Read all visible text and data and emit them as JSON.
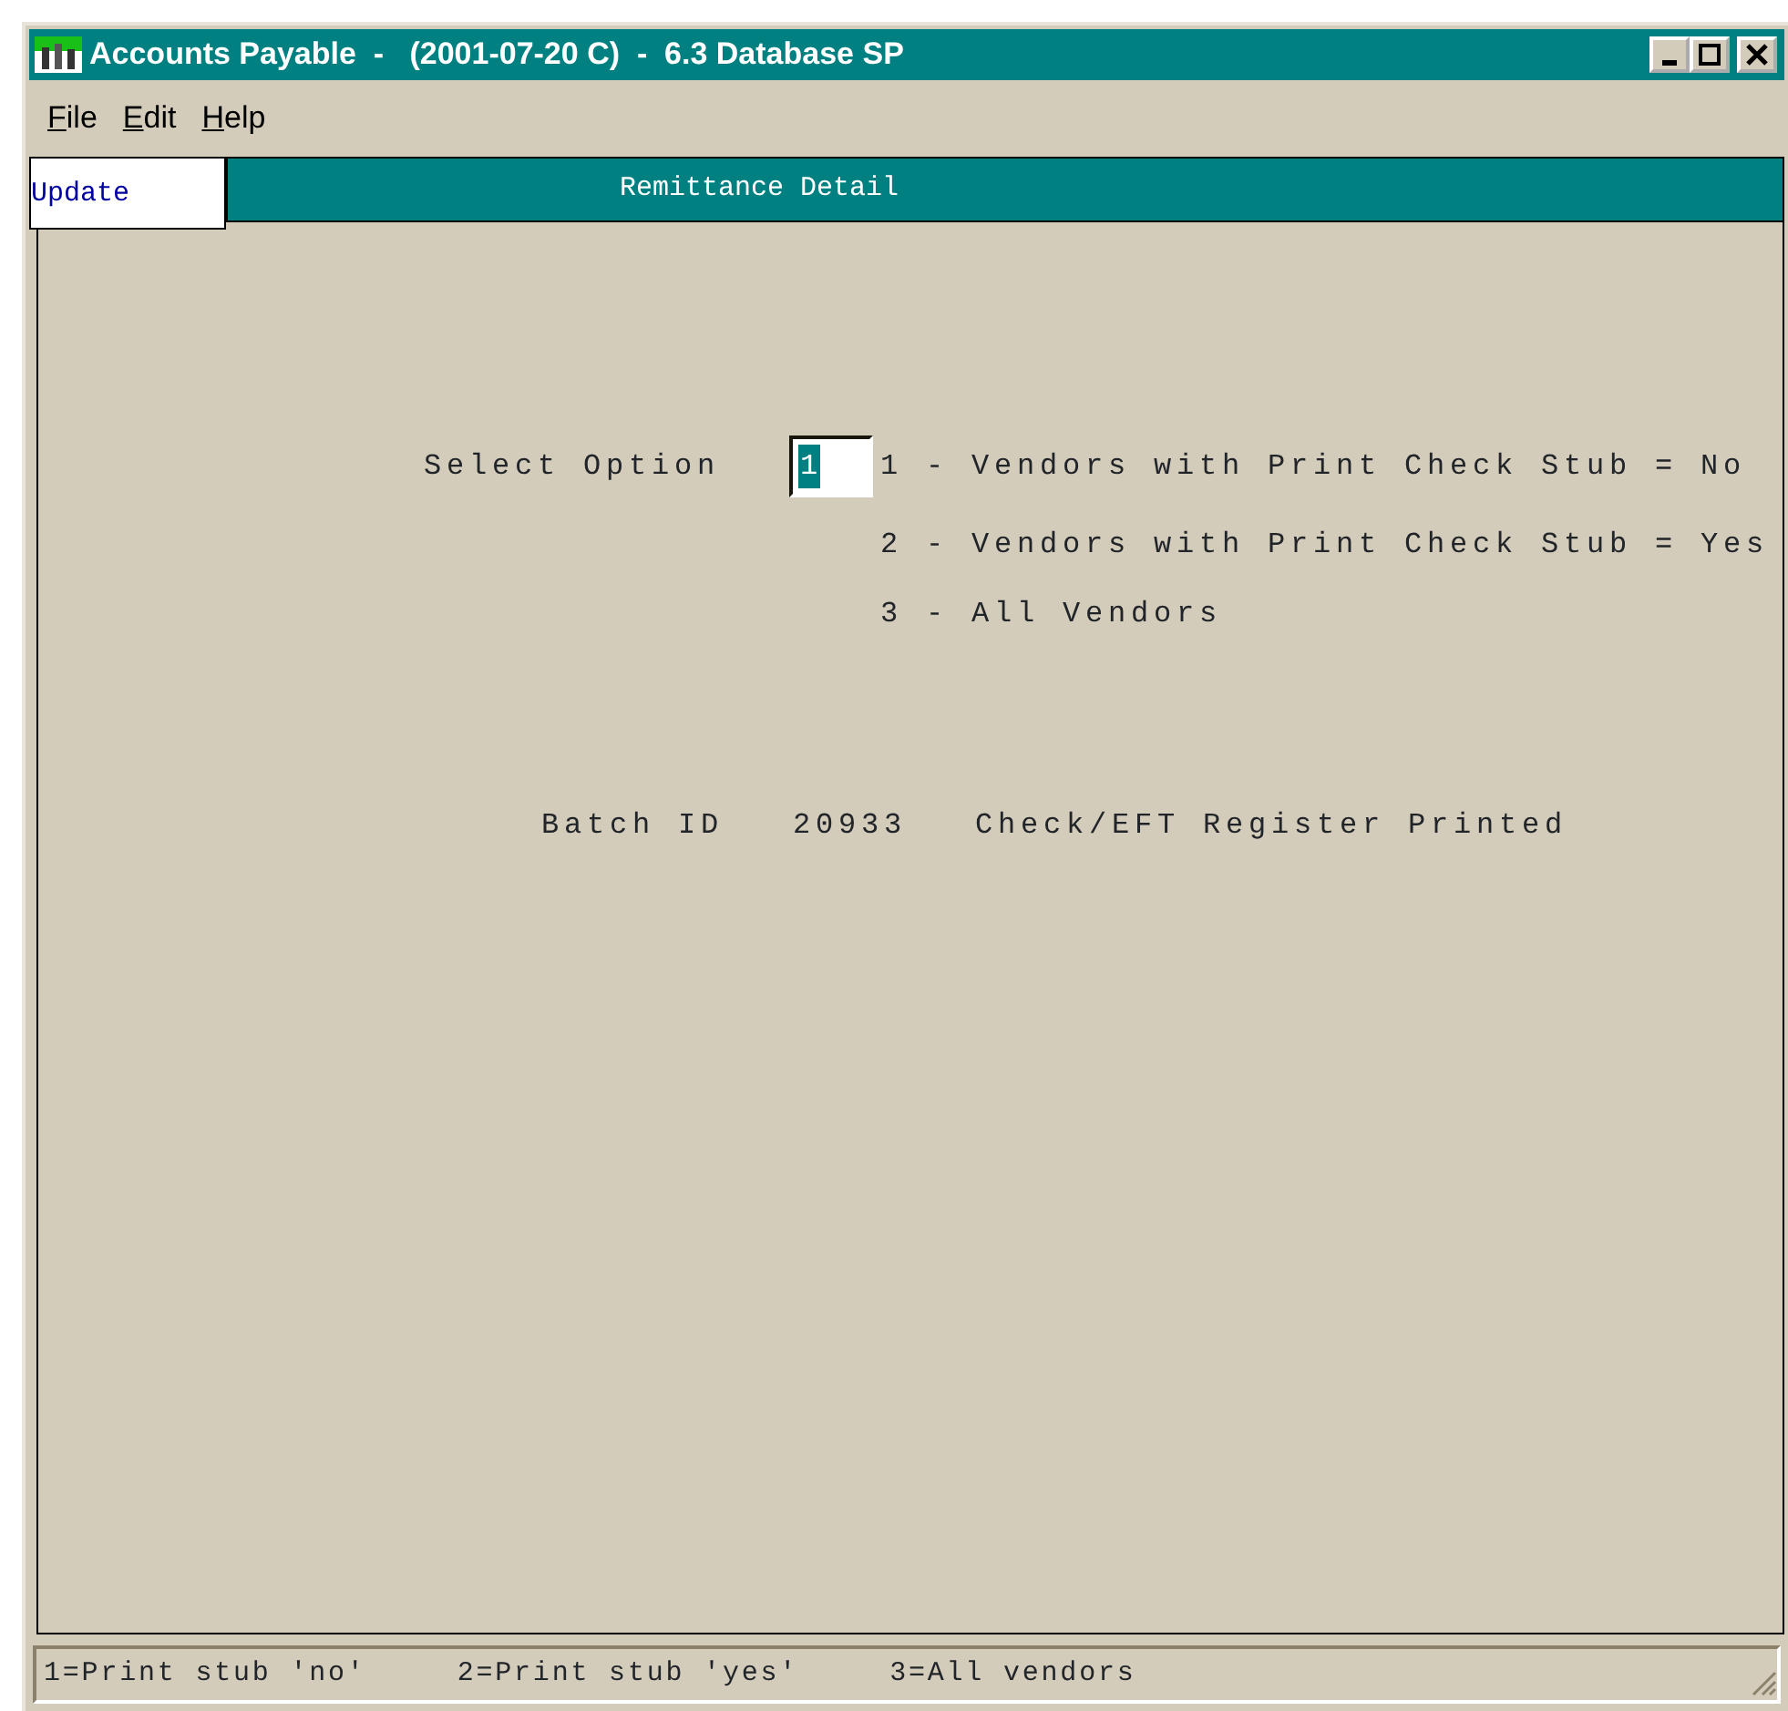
{
  "window": {
    "title": "Accounts Payable  -   (2001-07-20 C)  -  6.3 Database SP"
  },
  "menu": [
    "File",
    "Edit",
    "Help"
  ],
  "mode": "Update",
  "screen_title": "Remittance Detail",
  "select_option": {
    "label": "Select Option",
    "value": "1",
    "options": [
      "1 - Vendors with Print Check Stub = No",
      "2 - Vendors with Print Check Stub = Yes",
      "3 - All Vendors"
    ]
  },
  "batch": {
    "label": "Batch ID",
    "value": "20933",
    "status": "Check/EFT Register Printed"
  },
  "status_bar": [
    "1=Print stub 'no'",
    "2=Print stub 'yes'",
    "3=All vendors"
  ]
}
